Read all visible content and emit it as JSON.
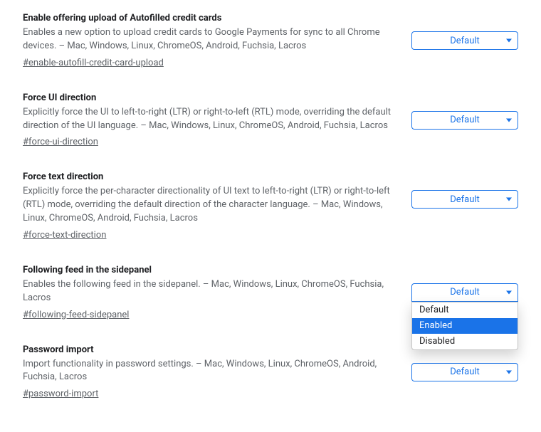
{
  "select_default_label": "Default",
  "dropdown_options": [
    "Default",
    "Enabled",
    "Disabled"
  ],
  "dropdown_highlight_index": 1,
  "flags": [
    {
      "title": "Enable offering upload of Autofilled credit cards",
      "desc": "Enables a new option to upload credit cards to Google Payments for sync to all Chrome devices. – Mac, Windows, Linux, ChromeOS, Android, Fuchsia, Lacros",
      "anchor": "#enable-autofill-credit-card-upload",
      "value": "Default",
      "open": false
    },
    {
      "title": "Force UI direction",
      "desc": "Explicitly force the UI to left-to-right (LTR) or right-to-left (RTL) mode, overriding the default direction of the UI language. – Mac, Windows, Linux, ChromeOS, Android, Fuchsia, Lacros",
      "anchor": "#force-ui-direction",
      "value": "Default",
      "open": false
    },
    {
      "title": "Force text direction",
      "desc": "Explicitly force the per-character directionality of UI text to left-to-right (LTR) or right-to-left (RTL) mode, overriding the default direction of the character language. – Mac, Windows, Linux, ChromeOS, Android, Fuchsia, Lacros",
      "anchor": "#force-text-direction",
      "value": "Default",
      "open": false
    },
    {
      "title": "Following feed in the sidepanel",
      "desc": "Enables the following feed in the sidepanel. – Mac, Windows, Linux, ChromeOS, Fuchsia, Lacros",
      "anchor": "#following-feed-sidepanel",
      "value": "Default",
      "open": true
    },
    {
      "title": "Password import",
      "desc": "Import functionality in password settings. – Mac, Windows, Linux, ChromeOS, Android, Fuchsia, Lacros",
      "anchor": "#password-import",
      "value": "Default",
      "open": false
    }
  ]
}
